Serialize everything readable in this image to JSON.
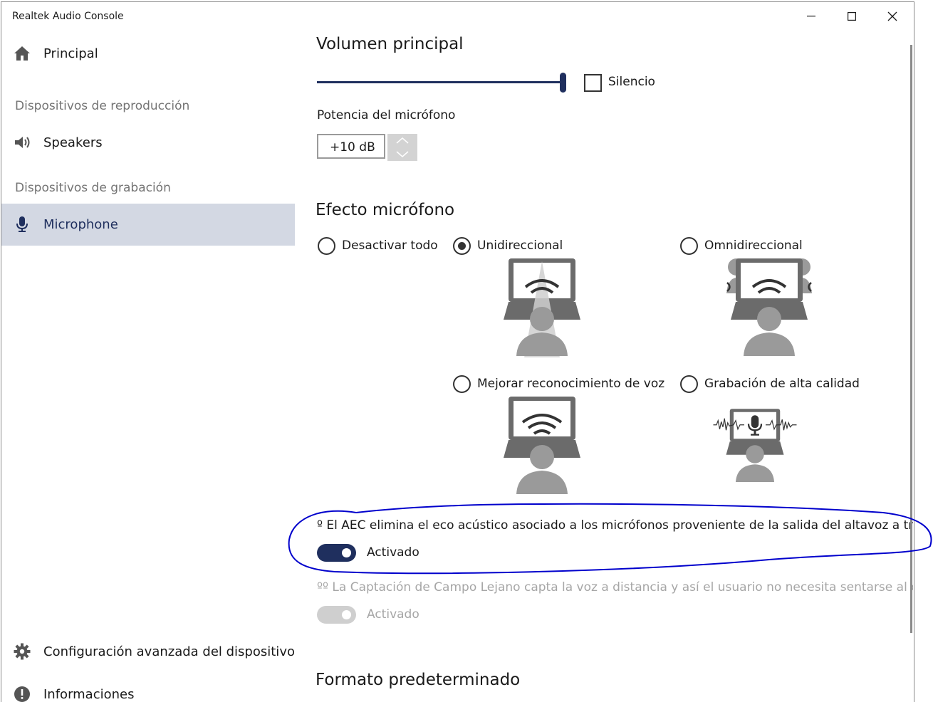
{
  "window": {
    "title": "Realtek Audio Console"
  },
  "sidebar": {
    "home_label": "Principal",
    "playback_header": "Dispositivos de reproducción",
    "playback_device": "Speakers",
    "recording_header": "Dispositivos de grabación",
    "recording_device": "Microphone",
    "advanced_label": "Configuración avanzada del dispositivo",
    "info_label": "Informaciones"
  },
  "main": {
    "volume_title": "Volumen principal",
    "volume_level": 1.0,
    "mute_label": "Silencio",
    "mute_checked": false,
    "boost_label": "Potencia del micrófono",
    "boost_value": "+10 dB",
    "effects_title": "Efecto micrófono",
    "effects": [
      {
        "label": "Desactivar todo",
        "selected": false
      },
      {
        "label": "Unidireccional",
        "selected": true
      },
      {
        "label": "Omnidireccional",
        "selected": false
      },
      {
        "label": "Mejorar reconocimiento de voz",
        "selected": false
      },
      {
        "label": "Grabación de alta calidad",
        "selected": false
      }
    ],
    "aec_note": "º El AEC elimina el eco acústico asociado a los micrófonos proveniente de la salida del altavoz a través",
    "aec_toggle_label": "Activado",
    "aec_on": true,
    "farfield_note": "ºº La Captación de Campo Lejano capta la voz a distancia y así el usuario no necesita sentarse al comp",
    "farfield_toggle_label": "Activado",
    "farfield_on": true,
    "format_title": "Formato predeterminado"
  },
  "colors": {
    "accent": "#1f2f5e",
    "selected_nav_bg": "#d3d8e3",
    "section_header": "#747474",
    "disabled": "#a6a6a6",
    "annotation_ink": "#0000cc"
  },
  "icons": {
    "home": "home-icon",
    "speaker": "speaker-icon",
    "microphone": "microphone-icon",
    "settings": "gear-icon",
    "info": "info-icon"
  }
}
